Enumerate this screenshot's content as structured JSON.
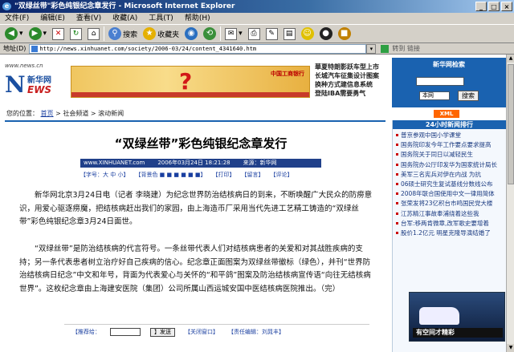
{
  "window": {
    "title": "\"双绿丝带\"彩色纯银纪念章发行 - Microsoft Internet Explorer"
  },
  "menu": [
    "文件(F)",
    "编辑(E)",
    "查看(V)",
    "收藏(A)",
    "工具(T)",
    "帮助(H)"
  ],
  "toolbar": {
    "search": "搜索",
    "favorites": "收藏夹"
  },
  "address": {
    "label": "地址(D)",
    "url": "http://news.xinhuanet.com/society/2006-03/24/content_4341640.htm",
    "extra": "转到  链接"
  },
  "logo": {
    "url": "www.news.cn",
    "name": "新华网",
    "sub": "EWS"
  },
  "banner": {
    "bank": "中国工商银行"
  },
  "toplinks": [
    "華夏特朗影跃车型上市",
    "长城汽车征集设计图案",
    "换种方式建信息系统",
    "登陆IBA需要勇气"
  ],
  "search": {
    "title": "新华网检索",
    "select": "本网",
    "button": "搜索"
  },
  "xml_badge": "XML",
  "breadcrumb": {
    "prefix": "您的位置：",
    "home": "首页",
    "s1": "社会频道",
    "s2": "滚动新闻"
  },
  "article": {
    "headline": "“双绿丝带”彩色纯银纪念章发行",
    "meta": [
      "www.XINHUANET.com",
      "2006年03月24日 18:21:28",
      "来源：新华网"
    ],
    "tools": [
      "【字号：大 中 小】",
      "【背景色 ■ ■ ■ ■ ■ ■】",
      "【打印】",
      "【留言】",
      "【评论】"
    ],
    "p1": "新华网北京3月24日电（记者 李晓建）为纪念世界防治结核病日的到来，不断唤醒广大民众的防痨意识，用爱心驱逐痨魔，把结核病赶出我们的家园，由上海造币厂采用当代先进工艺精工铸造的“双绿丝带”彩色纯银纪念章3月24日面世。",
    "p2": "“双绿丝带”是防治结核病的代言符号。一条丝带代表人们对结核病患者的关爱和对其战胜疾病的支持；另一条代表患者树立治疗好自己疾病的信心。纪念章正面图案为双绿丝带徽标（绿色），并刊“世界防治结核病日纪念”中文和年号，背面为代表爱心与关怀的“和平鸽”图案及防治结核病宣传语“向往无结核病世界”。这枚纪念章由上海建安医院（集团）公司所属山西运城安国中医结核病医院推出。（完）"
  },
  "sidebar": {
    "head": "24小时新闻排行",
    "items": [
      "普京参观中国小学课堂",
      "国务院印发今年工作要点要求提高",
      "国务院关于同日以减轻民生",
      "国务院办公厅印发华为国家统计局长",
      "美军三名宪兵对伊在内战 为抗",
      "06硕士研究生复试基线分数线公布",
      "2008年联合国使用中文一律用简体",
      "张荣发将23亿积台市鸣国民党大楼",
      "江苏精江事故奉浦绕着这些我",
      "台军:移两肯微章,改军歌史要增着",
      "股价1.2亿元 明星克隆导演结婚了"
    ],
    "ad": "有空间才精彩"
  },
  "bottom": {
    "recommend": "【推荐给：",
    "send": "】发送",
    "close": "【关闭窗口】",
    "editor": "【责任编辑：刘晁丰】"
  }
}
